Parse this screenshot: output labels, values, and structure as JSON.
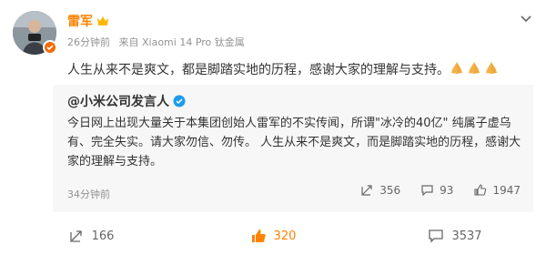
{
  "post": {
    "author": "雷军",
    "meta": {
      "time": "26分钟前",
      "source": "来自 Xiaomi 14 Pro 钛金属"
    },
    "text": "人生从来不是爽文，都是脚踏实地的历程，感谢大家的理解与支持。"
  },
  "repost": {
    "author": "@小米公司发言人",
    "text": "今日网上出现大量关于本集团创始人雷军的不实传闻，所谓\"冰冷的40亿\" 纯属子虚乌有、完全失实。请大家勿信、勿传。 人生从来不是爽文，而是脚踏实地的历程，感谢大家的理解与支持。",
    "time": "34分钟前",
    "stats": {
      "reposts": "356",
      "comments": "93",
      "likes": "1947"
    }
  },
  "actions": {
    "reposts": "166",
    "likes": "320",
    "comments": "3537"
  },
  "colors": {
    "brand_orange": "#ff8200",
    "verified_blue": "#1f9bea",
    "muted": "#939393"
  }
}
